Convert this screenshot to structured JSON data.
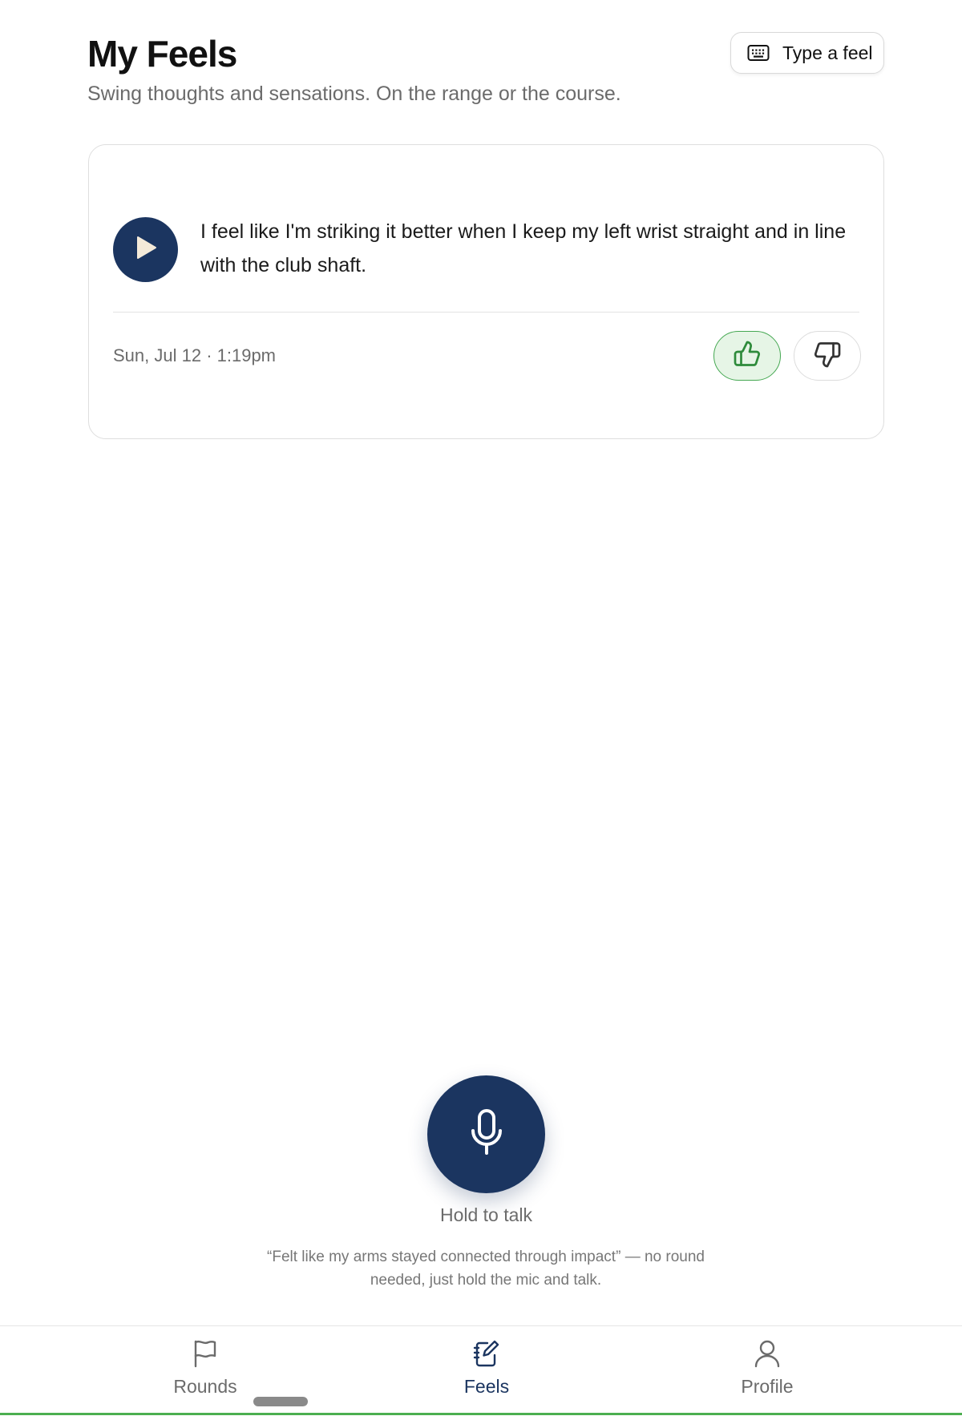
{
  "header": {
    "title": "My Feels",
    "subtitle": "Swing thoughts and sensations. On the range or the course.",
    "type_button_label": "Type a feel",
    "type_button_icon": "keyboard-icon"
  },
  "feels": [
    {
      "text": "I feel like I'm striking it better when I keep my left wrist straight and in line with the club shaft.",
      "timestamp": "Sun, Jul 12 · 1:19pm",
      "rating": "thumbs-up",
      "play_icon": "play-icon"
    }
  ],
  "recorder": {
    "label": "Hold to talk",
    "hint": "“Felt like my arms stayed connected through impact” — no round needed, just hold the mic and talk.",
    "icon": "microphone-icon"
  },
  "nav": {
    "items": [
      {
        "label": "Rounds",
        "icon": "flag-icon",
        "active": false
      },
      {
        "label": "Feels",
        "icon": "notebook-edit-icon",
        "active": true
      },
      {
        "label": "Profile",
        "icon": "person-icon",
        "active": false
      }
    ]
  },
  "colors": {
    "primary": "#1b3560",
    "positive_bg": "#e6f5e6",
    "positive_border": "#45a852",
    "muted_text": "#6b6b6b",
    "accent_strip": "#4caf50"
  }
}
